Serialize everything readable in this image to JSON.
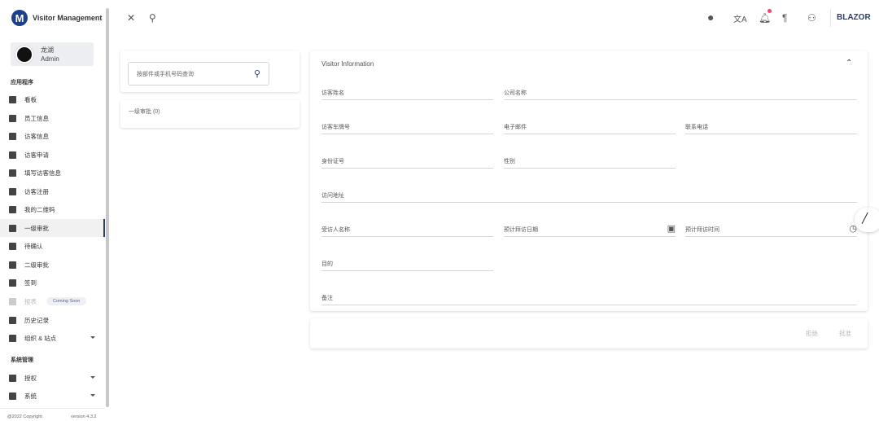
{
  "app": {
    "title": "Visitor Management",
    "logo_letter": "M",
    "brand": "BLAZOR"
  },
  "user": {
    "name": "龙湖",
    "role": "Admin"
  },
  "sidebar": {
    "section_apps": "应用程序",
    "items": [
      {
        "label": "看板",
        "icon": "dashboard-icon"
      },
      {
        "label": "员工信息",
        "icon": "badge-icon"
      },
      {
        "label": "访客信息",
        "icon": "run-icon"
      },
      {
        "label": "访客申请",
        "icon": "post-add-icon"
      },
      {
        "label": "填写访客信息",
        "icon": "edit-note-icon"
      },
      {
        "label": "访客注册",
        "icon": "book-icon"
      },
      {
        "label": "我的二维码",
        "icon": "qr-code-icon"
      },
      {
        "label": "一级审批",
        "icon": "approval-icon",
        "active": true
      },
      {
        "label": "待确认",
        "icon": "fact-check-icon"
      },
      {
        "label": "二级审批",
        "icon": "people-icon"
      },
      {
        "label": "签到",
        "icon": "shutter-icon"
      },
      {
        "label": "报表",
        "icon": "chart-icon",
        "disabled": true,
        "badge": "Coming Soon"
      },
      {
        "label": "历史记录",
        "icon": "history-icon"
      },
      {
        "label": "组织 & 站点",
        "icon": "domain-icon",
        "expandable": true
      }
    ],
    "section_system": "系统管理",
    "system_items": [
      {
        "label": "授权",
        "icon": "manage-accounts-icon",
        "expandable": true
      },
      {
        "label": "系统",
        "icon": "devices-icon",
        "expandable": true
      }
    ],
    "copyright": "@2022 Copyright",
    "version": "version 4.3.2"
  },
  "search": {
    "placeholder": "按部件或手机号码查询"
  },
  "list": {
    "title": "一级审批 (0)"
  },
  "visitor_form": {
    "title": "Visitor Information",
    "fields": {
      "name": "访客姓名",
      "company": "公司名称",
      "plate": "访客车牌号",
      "email": "电子邮件",
      "phone": "联系电话",
      "id_number": "身份证号",
      "gender": "性别",
      "address": "访问地址",
      "host": "受访人名称",
      "visit_date": "预计拜访日期",
      "visit_time": "预计拜访时间",
      "purpose": "目的",
      "remark": "备注"
    }
  },
  "actions": {
    "reject": "拒绝",
    "approve": "批准"
  }
}
